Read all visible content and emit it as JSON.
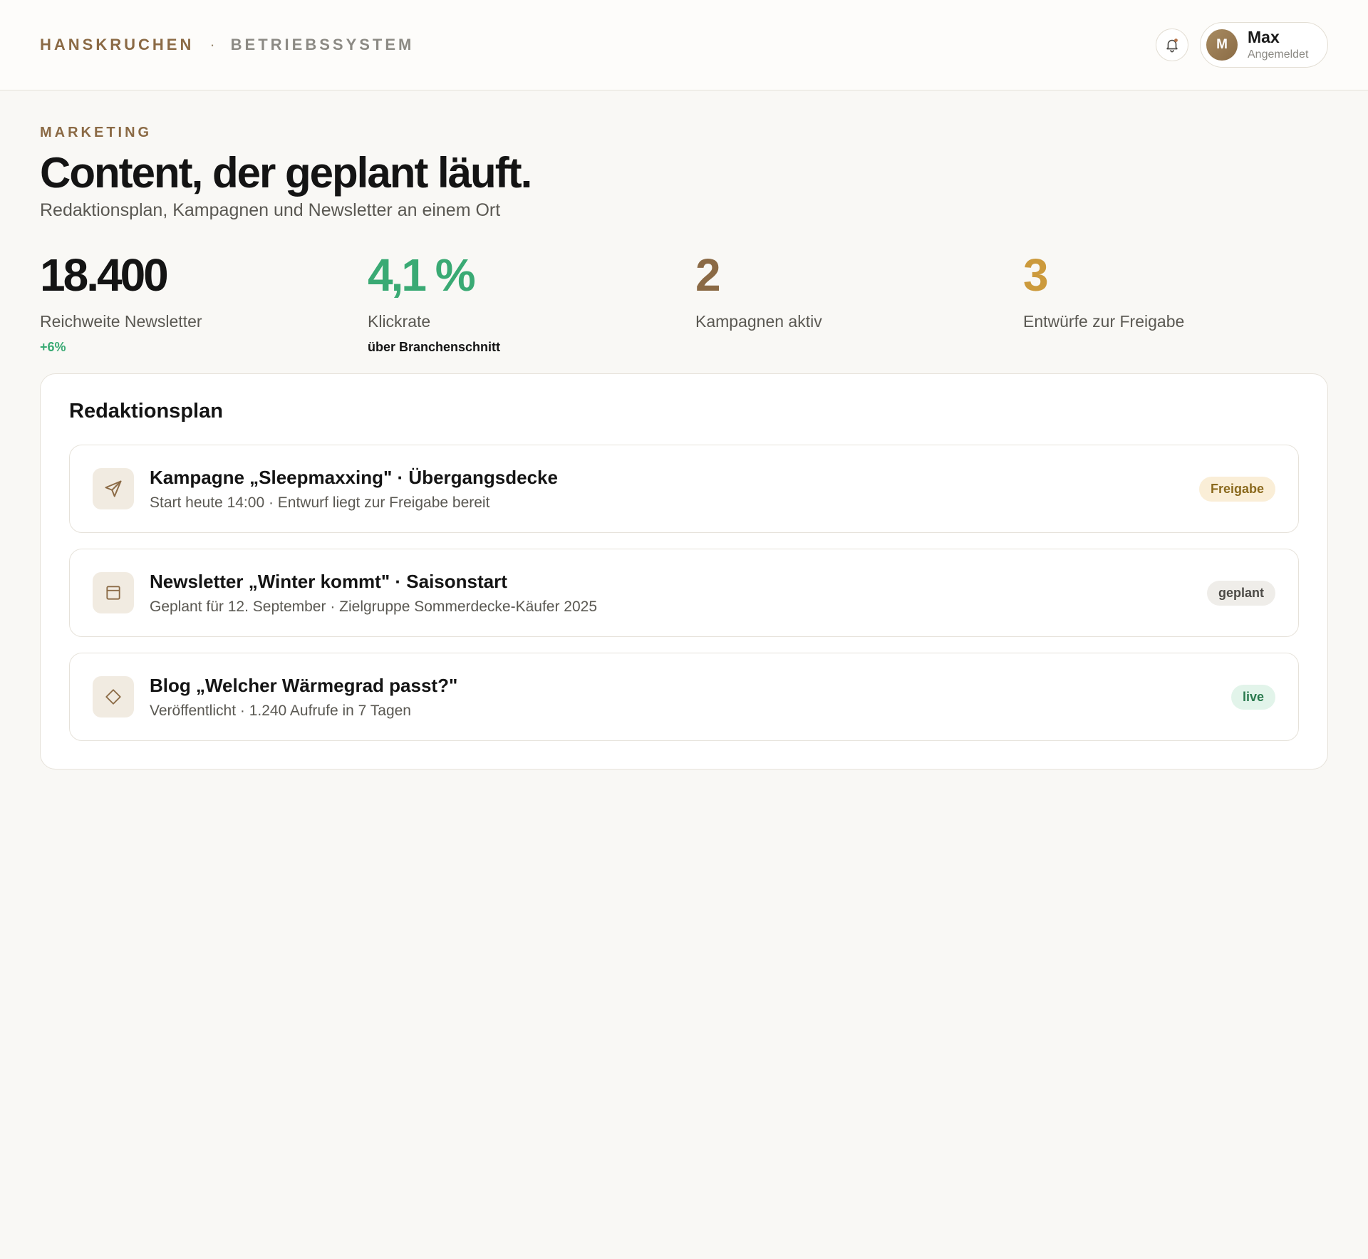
{
  "header": {
    "brand_name": "HANSKRUCHEN",
    "brand_separator": "·",
    "brand_sub": "BETRIEBSSYSTEM",
    "user": {
      "initial": "M",
      "name": "Max",
      "status": "Angemeldet"
    }
  },
  "page": {
    "eyebrow": "MARKETING",
    "title": "Content, der geplant läuft.",
    "subtitle": "Redaktionsplan, Kampagnen und Newsletter an einem Ort"
  },
  "stats": [
    {
      "value": "18.400",
      "label": "Reichweite Newsletter",
      "note": "+6%",
      "color": "#141414",
      "note_color": "#3aaa74"
    },
    {
      "value": "4,1 %",
      "label": "Klickrate",
      "note": "über Branchenschnitt",
      "color": "#3aaa74",
      "note_color": "#141414"
    },
    {
      "value": "2",
      "label": "Kampagnen aktiv",
      "note": "",
      "color": "#8b6a45",
      "note_color": "#141414"
    },
    {
      "value": "3",
      "label": "Entwürfe zur Freigabe",
      "note": "",
      "color": "#cc9a3c",
      "note_color": "#141414"
    }
  ],
  "plan": {
    "title": "Redaktionsplan",
    "items": [
      {
        "icon": "send-icon",
        "title": "Kampagne „Sleepmaxxing\" · Übergangsdecke",
        "meta": "Start heute 14:00 · Entwurf liegt zur Freigabe bereit",
        "badge": "Freigabe"
      },
      {
        "icon": "calendar-icon",
        "title": "Newsletter „Winter kommt\" · Saisonstart",
        "meta": "Geplant für 12. September · Zielgruppe Sommerdecke-Käufer 2025",
        "badge": "geplant"
      },
      {
        "icon": "diamond-icon",
        "title": "Blog „Welcher Wärmegrad passt?\"",
        "meta": "Veröffentlicht · 1.240 Aufrufe in 7 Tagen",
        "badge": "live"
      }
    ]
  },
  "colors": {
    "accent": "#8b6a45",
    "success": "#3aaa74",
    "warning": "#cc9a3c",
    "background": "#f9f8f5"
  }
}
